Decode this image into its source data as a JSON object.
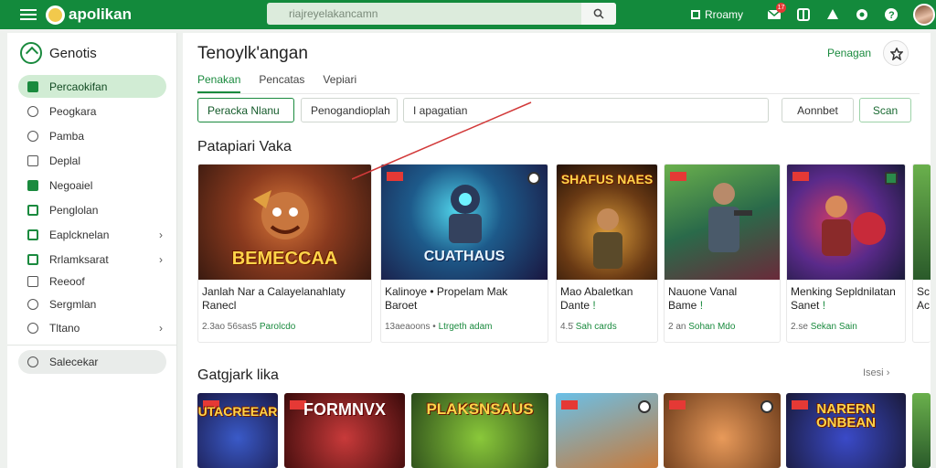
{
  "topbar": {
    "app_name": "apolikan",
    "search_placeholder": "riajreyelakancamn",
    "library_label": "Rroamy",
    "notification_count": "17"
  },
  "sidebar": {
    "header": "Genotis",
    "items": [
      {
        "label": "Percaokifan",
        "active": true
      },
      {
        "label": "Peogkara"
      },
      {
        "label": "Pamba"
      },
      {
        "label": "Deplal"
      },
      {
        "label": "Negoaiel"
      },
      {
        "label": "Penglolan"
      },
      {
        "label": "Eaplcknelan",
        "chevron": true
      },
      {
        "label": "Rrlamksarat",
        "chevron": true
      },
      {
        "label": "Reeoof"
      },
      {
        "label": "Sergmlan"
      },
      {
        "label": "Tltano",
        "chevron": true
      }
    ],
    "footer": "Salecekar"
  },
  "main": {
    "title": "Tenoylk'angan",
    "top_link": "Penagan",
    "tabs": [
      "Penakan",
      "Pencatas",
      "Vepiari"
    ],
    "filters": [
      "Peracka Nlanu",
      "Penogandioplah",
      "I apagatian",
      "Aonnbet",
      "Scan"
    ],
    "section1": "Patapiari Vaka",
    "section2": "Gatgjark lika",
    "section2_more": "Isesi",
    "cards": [
      {
        "art_text": "BEMECCAA",
        "title": "Janlah Nar a Calayelanahlaty",
        "title2": "Ranecl",
        "meta": "2.3ao 56sas5",
        "meta_hl": "Parolcdo"
      },
      {
        "art_text": "CUATHAUS",
        "title": "Kalinoye • Propelam Mak",
        "title2": "Baroet",
        "meta": "13aeaoons •",
        "meta_hl": "Ltrgeth adam"
      },
      {
        "art_text": "SHAFUS NAES",
        "title": "Mao Abaletkan",
        "title2": "Dante",
        "meta": "4.5̇",
        "meta_hl": "Sah cards"
      },
      {
        "art_text": "",
        "title": "Nauone Vanal",
        "title2": "Bame",
        "meta": "2 an",
        "meta_hl": "Sohan Mdo"
      },
      {
        "art_text": "",
        "title": "Menking Sepldnilatan",
        "title2": "Sanet",
        "meta": "2.se",
        "meta_hl": "Sekan Sain"
      },
      {
        "art_text": "",
        "title": "Sc",
        "title2": "Ac",
        "meta": "",
        "meta_hl": ""
      }
    ],
    "tiles": [
      "UTACREEAR",
      "FORMNVX",
      "PLAKSNSAUS",
      "",
      "",
      "NARERN ONBEAN",
      ""
    ]
  },
  "colors": {
    "brand": "#138a3c",
    "accent": "#1a8a3e",
    "active_nav_bg": "#d1ecd4"
  }
}
